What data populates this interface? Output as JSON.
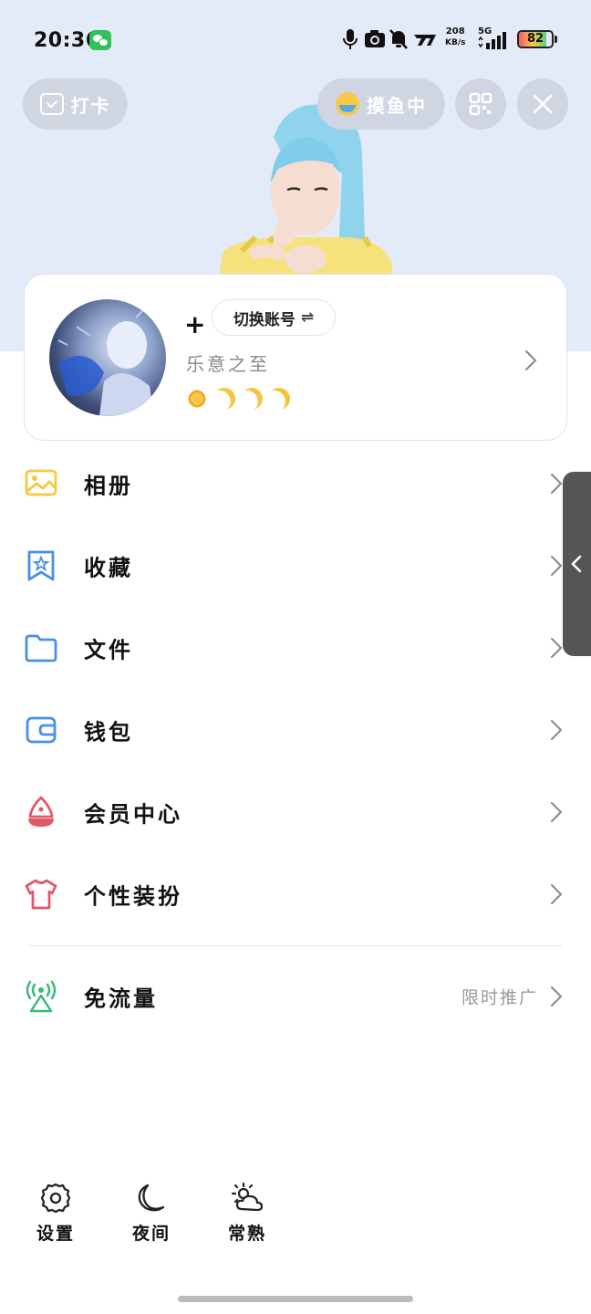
{
  "status_bar": {
    "time": "20:36",
    "net_speed_value": "208",
    "net_speed_unit": "KB/s",
    "net_type": "5G",
    "battery": "82",
    "battery_level": 0.82
  },
  "top_buttons": {
    "checkin_label": "打卡",
    "status_label": "摸鱼中"
  },
  "profile": {
    "plus": "+",
    "switch_account_label": "切换账号",
    "switch_arrows": "⇌",
    "nickname": "乐意之至"
  },
  "menu": {
    "items": [
      {
        "label": "相册",
        "icon": "album-icon",
        "color": "#f5c842"
      },
      {
        "label": "收藏",
        "icon": "favorite-icon",
        "color": "#4a90e2"
      },
      {
        "label": "文件",
        "icon": "folder-icon",
        "color": "#4a90e2"
      },
      {
        "label": "钱包",
        "icon": "wallet-icon",
        "color": "#4a90e2"
      },
      {
        "label": "会员中心",
        "icon": "vip-icon",
        "color": "#e05a6a"
      },
      {
        "label": "个性装扮",
        "icon": "tshirt-icon",
        "color": "#e05a6a"
      }
    ],
    "free_data": {
      "label": "免流量",
      "tag": "限时推广",
      "icon": "signal-person-icon",
      "color": "#3cba7a"
    }
  },
  "bottom": {
    "settings_label": "设置",
    "night_label": "夜间",
    "weather_label": "常熟"
  }
}
